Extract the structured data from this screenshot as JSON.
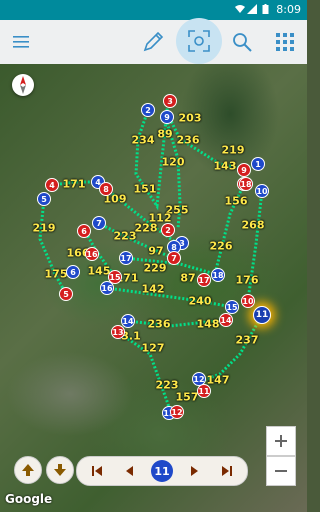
{
  "status": {
    "time": "8:09"
  },
  "toolbar": {
    "icons": [
      "menu-icon",
      "pencil-icon",
      "scan-icon",
      "search-icon",
      "grid-icon"
    ]
  },
  "map": {
    "attribution": "Google",
    "distances": [
      "203",
      "234",
      "89",
      "236",
      "219",
      "120",
      "143",
      "171",
      "151",
      "109",
      "255",
      "219",
      "112",
      "268",
      "223",
      "156",
      "166",
      "228",
      "97",
      "226",
      "145",
      "171",
      "229",
      "87",
      "175",
      "142",
      "176",
      "240",
      "236",
      "148",
      "3.1",
      "127",
      "237",
      "147",
      "223",
      "157"
    ],
    "holes": [
      "1",
      "2",
      "3",
      "4",
      "5",
      "6",
      "7",
      "8",
      "9",
      "10",
      "11",
      "12",
      "13",
      "14",
      "15",
      "16",
      "17",
      "18"
    ],
    "route_color": "#00e08a",
    "tee_color": "#1f49c9",
    "green_color": "#d41e1e",
    "highlight_color": "#ffb300"
  },
  "player": {
    "current_hole": "11"
  }
}
